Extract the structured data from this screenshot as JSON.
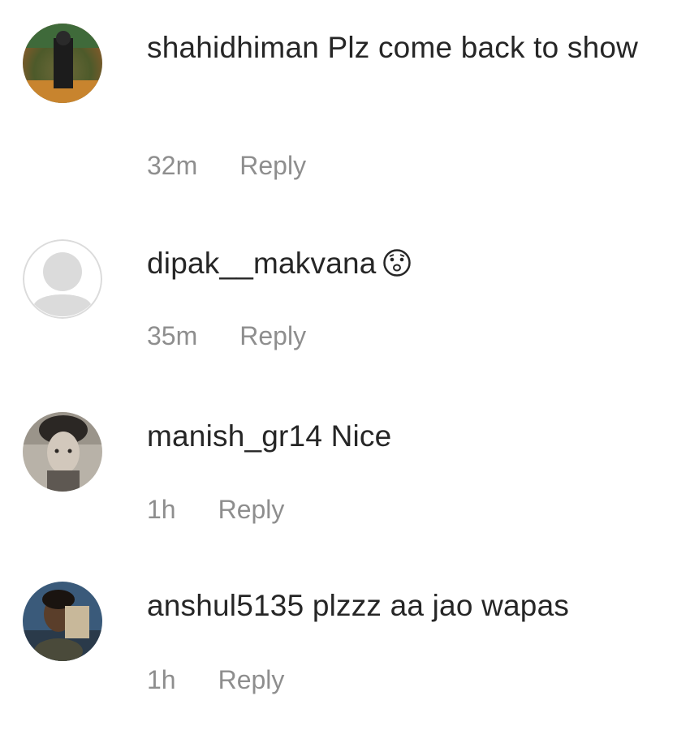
{
  "comments": [
    {
      "username": "shahidhiman",
      "text": "Plz come back to show",
      "time": "32m",
      "reply_label": "Reply"
    },
    {
      "username": "dipak__makvana",
      "text": "",
      "emoji": "hushed-face-emoji",
      "time": "35m",
      "reply_label": "Reply"
    },
    {
      "username": "manish_gr14",
      "text": "Nice",
      "time": "1h",
      "reply_label": "Reply"
    },
    {
      "username": "anshul5135",
      "text": "plzzz aa jao wapas",
      "time": "1h",
      "reply_label": "Reply"
    }
  ],
  "colors": {
    "text_primary": "#262626",
    "text_secondary": "#8e8e8e",
    "placeholder_avatar": "#dbdbdb"
  }
}
